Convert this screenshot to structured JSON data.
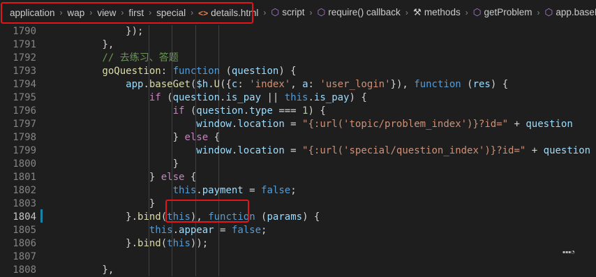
{
  "breadcrumb": [
    {
      "label": "application",
      "icon": ""
    },
    {
      "label": "wap",
      "icon": ""
    },
    {
      "label": "view",
      "icon": ""
    },
    {
      "label": "first",
      "icon": ""
    },
    {
      "label": "special",
      "icon": ""
    },
    {
      "label": "details.html",
      "icon": "html-file-icon"
    },
    {
      "label": "script",
      "icon": "symbol-cube-icon"
    },
    {
      "label": "require() callback",
      "icon": "symbol-cube-icon"
    },
    {
      "label": "methods",
      "icon": "wrench-icon"
    },
    {
      "label": "getProblem",
      "icon": "symbol-cube-icon"
    },
    {
      "label": "app.basePost",
      "icon": "symbol-cube-icon"
    }
  ],
  "active_line": "1804",
  "lines": [
    {
      "n": "1790",
      "tokens": [
        [
          "d",
          "            });"
        ]
      ]
    },
    {
      "n": "1791",
      "tokens": [
        [
          "d",
          "        },"
        ]
      ]
    },
    {
      "n": "1792",
      "tokens": [
        [
          "c",
          "        // 去练习、答题"
        ]
      ]
    },
    {
      "n": "1793",
      "tokens": [
        [
          "f",
          "        goQuestion"
        ],
        [
          "d",
          ": "
        ],
        [
          "k",
          "function"
        ],
        [
          "d",
          " ("
        ],
        [
          "v",
          "question"
        ],
        [
          "d",
          ") {"
        ]
      ]
    },
    {
      "n": "1794",
      "tokens": [
        [
          "v",
          "            app"
        ],
        [
          "d",
          "."
        ],
        [
          "f",
          "baseGet"
        ],
        [
          "d",
          "("
        ],
        [
          "v",
          "$h"
        ],
        [
          "d",
          "."
        ],
        [
          "f",
          "U"
        ],
        [
          "d",
          "({"
        ],
        [
          "v",
          "c"
        ],
        [
          "d",
          ": "
        ],
        [
          "s",
          "'index'"
        ],
        [
          "d",
          ", "
        ],
        [
          "v",
          "a"
        ],
        [
          "d",
          ": "
        ],
        [
          "s",
          "'user_login'"
        ],
        [
          "d",
          "}), "
        ],
        [
          "k",
          "function"
        ],
        [
          "d",
          " ("
        ],
        [
          "v",
          "res"
        ],
        [
          "d",
          ") {"
        ]
      ]
    },
    {
      "n": "1795",
      "tokens": [
        [
          "kw",
          "                if"
        ],
        [
          "d",
          " ("
        ],
        [
          "v",
          "question"
        ],
        [
          "d",
          "."
        ],
        [
          "v",
          "is_pay"
        ],
        [
          "d",
          " || "
        ],
        [
          "k",
          "this"
        ],
        [
          "d",
          "."
        ],
        [
          "v",
          "is_pay"
        ],
        [
          "d",
          ") {"
        ]
      ]
    },
    {
      "n": "1796",
      "tokens": [
        [
          "kw",
          "                    if"
        ],
        [
          "d",
          " ("
        ],
        [
          "v",
          "question"
        ],
        [
          "d",
          "."
        ],
        [
          "v",
          "type"
        ],
        [
          "d",
          " === "
        ],
        [
          "n",
          "1"
        ],
        [
          "d",
          ") {"
        ]
      ]
    },
    {
      "n": "1797",
      "tokens": [
        [
          "v",
          "                        window"
        ],
        [
          "d",
          "."
        ],
        [
          "v",
          "location"
        ],
        [
          "d",
          " = "
        ],
        [
          "s",
          "\"{:url('topic/problem_index')}?id=\""
        ],
        [
          "d",
          " + "
        ],
        [
          "v",
          "question"
        ]
      ]
    },
    {
      "n": "1798",
      "tokens": [
        [
          "d",
          "                    } "
        ],
        [
          "kw",
          "else"
        ],
        [
          "d",
          " {"
        ]
      ]
    },
    {
      "n": "1799",
      "tokens": [
        [
          "v",
          "                        window"
        ],
        [
          "d",
          "."
        ],
        [
          "v",
          "location"
        ],
        [
          "d",
          " = "
        ],
        [
          "s",
          "\"{:url('special/question_index')}?id=\""
        ],
        [
          "d",
          " + "
        ],
        [
          "v",
          "question"
        ]
      ]
    },
    {
      "n": "1800",
      "tokens": [
        [
          "d",
          "                    }"
        ]
      ]
    },
    {
      "n": "1801",
      "tokens": [
        [
          "d",
          "                } "
        ],
        [
          "kw",
          "else"
        ],
        [
          "d",
          " {"
        ]
      ]
    },
    {
      "n": "1802",
      "tokens": [
        [
          "k",
          "                    this"
        ],
        [
          "d",
          "."
        ],
        [
          "v",
          "payment"
        ],
        [
          "d",
          " = "
        ],
        [
          "k",
          "false"
        ],
        [
          "d",
          ";"
        ]
      ]
    },
    {
      "n": "1803",
      "tokens": [
        [
          "d",
          "                }"
        ]
      ]
    },
    {
      "n": "1804",
      "tokens": [
        [
          "d",
          "            }."
        ],
        [
          "f",
          "bind"
        ],
        [
          "d",
          "("
        ],
        [
          "k",
          "this"
        ],
        [
          "d",
          "), "
        ],
        [
          "k",
          "function"
        ],
        [
          "d",
          " ("
        ],
        [
          "v",
          "params"
        ],
        [
          "d",
          ") {"
        ]
      ]
    },
    {
      "n": "1805",
      "tokens": [
        [
          "k",
          "                this"
        ],
        [
          "d",
          "."
        ],
        [
          "v",
          "appear"
        ],
        [
          "d",
          " = "
        ],
        [
          "k",
          "false"
        ],
        [
          "d",
          ";"
        ]
      ]
    },
    {
      "n": "1806",
      "tokens": [
        [
          "d",
          "            }."
        ],
        [
          "f",
          "bind"
        ],
        [
          "d",
          "("
        ],
        [
          "k",
          "this"
        ],
        [
          "d",
          "));"
        ]
      ]
    },
    {
      "n": "1807",
      "tokens": [
        [
          "d",
          ""
        ]
      ]
    },
    {
      "n": "1808",
      "tokens": [
        [
          "d",
          "        },"
        ]
      ]
    }
  ],
  "colors": {
    "background": "#1e1e1e",
    "keyword": "#569cd6",
    "control": "#c586c0",
    "variable": "#9cdcfe",
    "function": "#dcdcaa",
    "string": "#ce9178",
    "number": "#b5cea8",
    "comment": "#6a9955",
    "annotation_box": "#e0161b"
  }
}
